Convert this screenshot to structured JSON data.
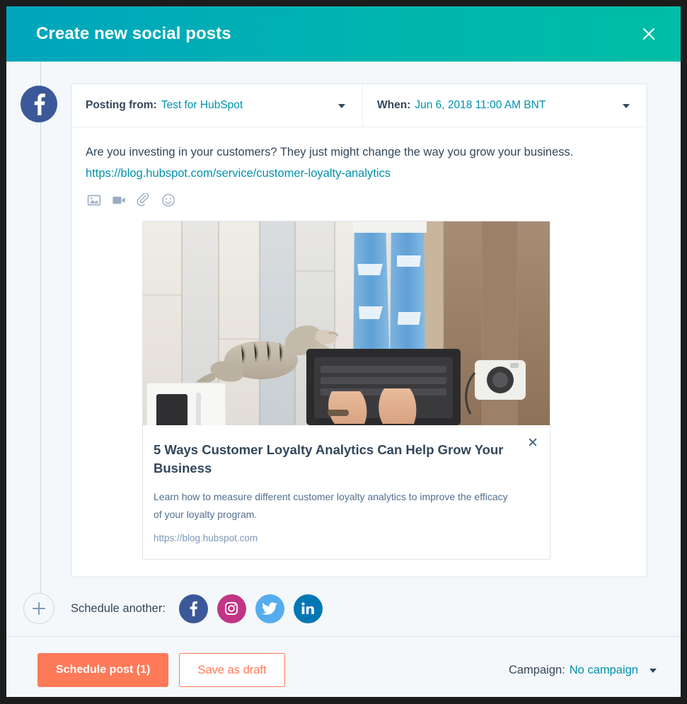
{
  "header": {
    "title": "Create new social posts",
    "close_label": "Close"
  },
  "post": {
    "network": "facebook",
    "posting_from": {
      "label": "Posting from:",
      "value": "Test for HubSpot"
    },
    "when": {
      "label": "When:",
      "value": "Jun 6, 2018 11:00 AM BNT"
    },
    "message": {
      "text_before_link": "Are you investing in your customers? They just might change the way you grow your business. ",
      "link_text": "https://blog.hubspot.com/service/customer-loyalty-analytics"
    },
    "tools": [
      {
        "name": "image-icon",
        "title": "Add image"
      },
      {
        "name": "video-icon",
        "title": "Add video"
      },
      {
        "name": "attachment-icon",
        "title": "Attach file"
      },
      {
        "name": "emoji-icon",
        "title": "Add emoji"
      }
    ],
    "attachment": {
      "image_alt": "Overhead photo of a person in ripped jeans typing on a laptop on whitewashed wood planks with a tabby cat, notebook and camera",
      "title": "5 Ways Customer Loyalty Analytics Can Help Grow Your Business",
      "description": "Learn how to measure different customer loyalty analytics to improve the efficacy of your loyalty program.",
      "url": "https://blog.hubspot.com",
      "remove_label": "Remove preview"
    }
  },
  "schedule_another": {
    "add_label": "Add post",
    "label": "Schedule another:",
    "networks": [
      {
        "name": "facebook-icon",
        "label": "Facebook",
        "color": "#3b5998"
      },
      {
        "name": "instagram-icon",
        "label": "Instagram",
        "color": "#c13584"
      },
      {
        "name": "twitter-icon",
        "label": "Twitter",
        "color": "#55acee"
      },
      {
        "name": "linkedin-icon",
        "label": "LinkedIn",
        "color": "#0077b5"
      }
    ]
  },
  "footer": {
    "primary_button": "Schedule post (1)",
    "secondary_button": "Save as draft",
    "campaign_label": "Campaign:",
    "campaign_value": "No campaign"
  },
  "colors": {
    "header_gradient_start": "#00a4bd",
    "header_gradient_end": "#00bda5",
    "accent_orange": "#ff7a59",
    "link_teal": "#0091ae",
    "text_dark": "#33475b",
    "background": "#f5f8fa"
  }
}
